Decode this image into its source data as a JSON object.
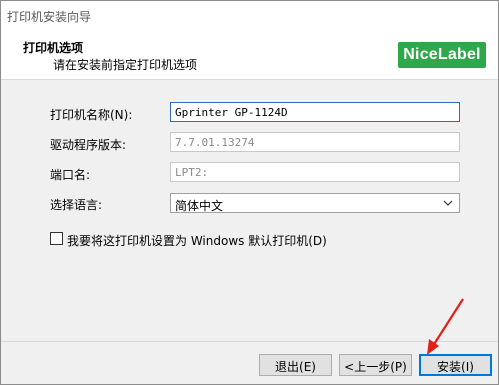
{
  "window": {
    "title": "打印机安装向导"
  },
  "header": {
    "title": "打印机选项",
    "subtitle": "请在安装前指定打印机选项",
    "logo_text": "NiceLabel",
    "logo_color": "#2ea84a"
  },
  "form": {
    "printer_name": {
      "label": "打印机名称(N):",
      "value": "Gprinter  GP-1124D"
    },
    "driver_version": {
      "label": "驱动程序版本:",
      "value": "7.7.01.13274"
    },
    "port": {
      "label": "端口名:",
      "value": "LPT2:"
    },
    "language": {
      "label": "选择语言:",
      "value": "简体中文"
    },
    "default_checkbox": {
      "label": "我要将这打印机设置为 Windows 默认打印机(D)",
      "checked": false
    }
  },
  "buttons": {
    "exit": "退出(E)",
    "back": "<上一步(P)",
    "install": "安装(I)"
  },
  "colors": {
    "accent": "#0078d7",
    "annotation_arrow": "#e0201a"
  }
}
